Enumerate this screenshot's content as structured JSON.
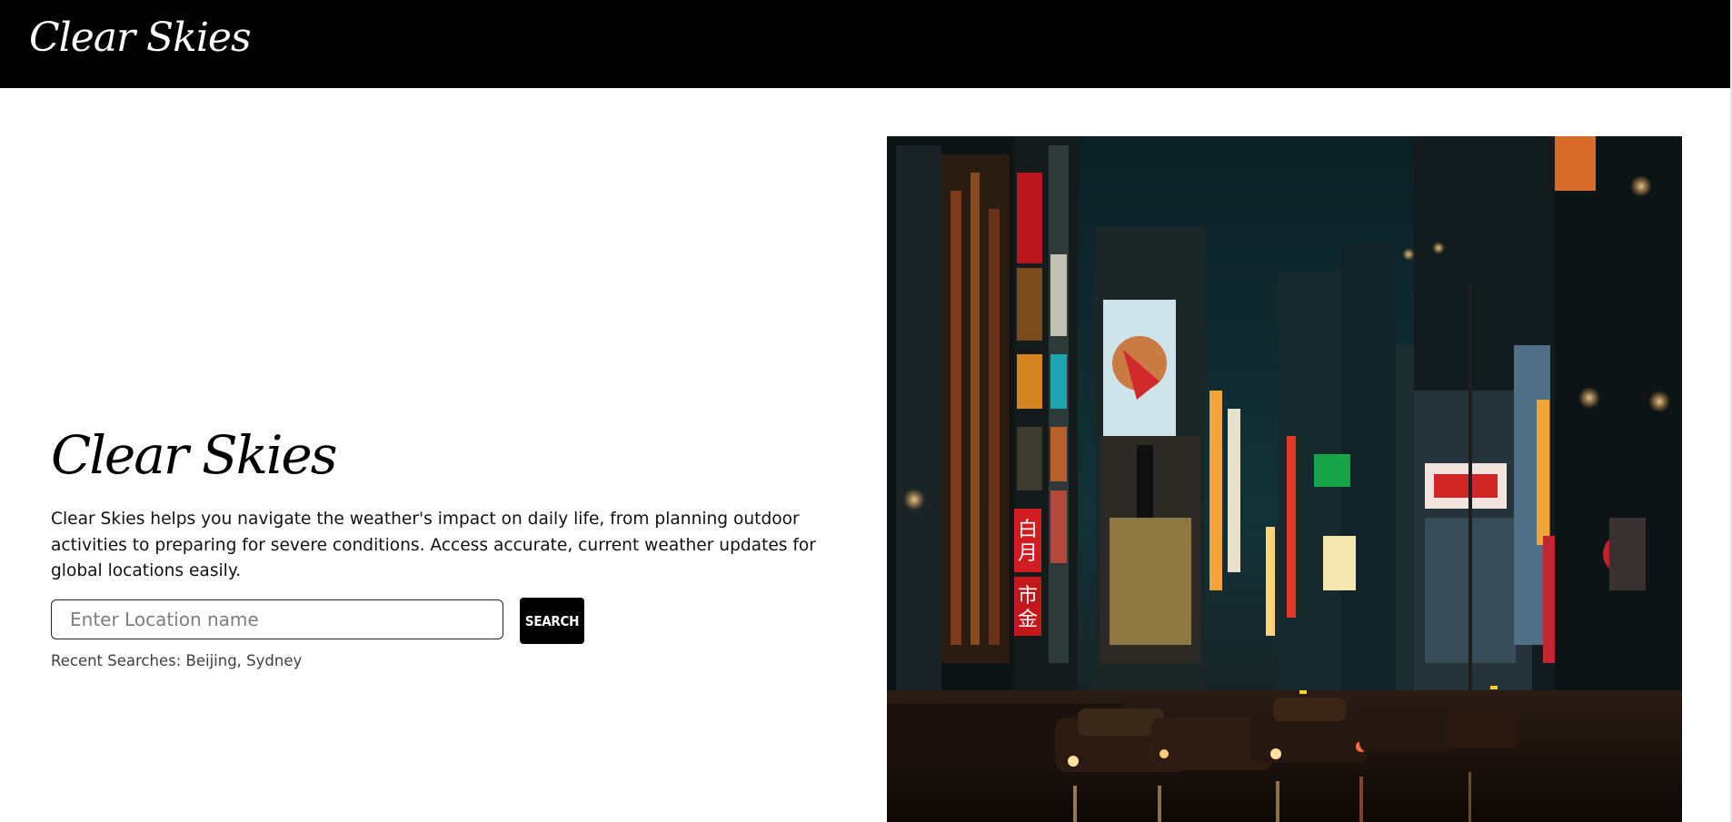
{
  "navbar": {
    "brand": "Clear Skies"
  },
  "hero": {
    "title": "Clear Skies",
    "description": "Clear Skies helps you navigate the weather's impact on daily life, from planning outdoor activities to preparing for severe conditions. Access accurate, current weather updates for global locations easily.",
    "search": {
      "placeholder": "Enter Location name",
      "value": "",
      "button_label": "SEARCH"
    },
    "recent_searches": "Recent Searches: Beijing, Sydney"
  },
  "image": {
    "alt": "Neon-lit city street at night with taxis",
    "sign_text": [
      "白",
      "月",
      "市",
      "金"
    ]
  },
  "colors": {
    "navbar_bg": "#000000",
    "button_bg": "#000000",
    "page_bg": "#ffffff"
  }
}
